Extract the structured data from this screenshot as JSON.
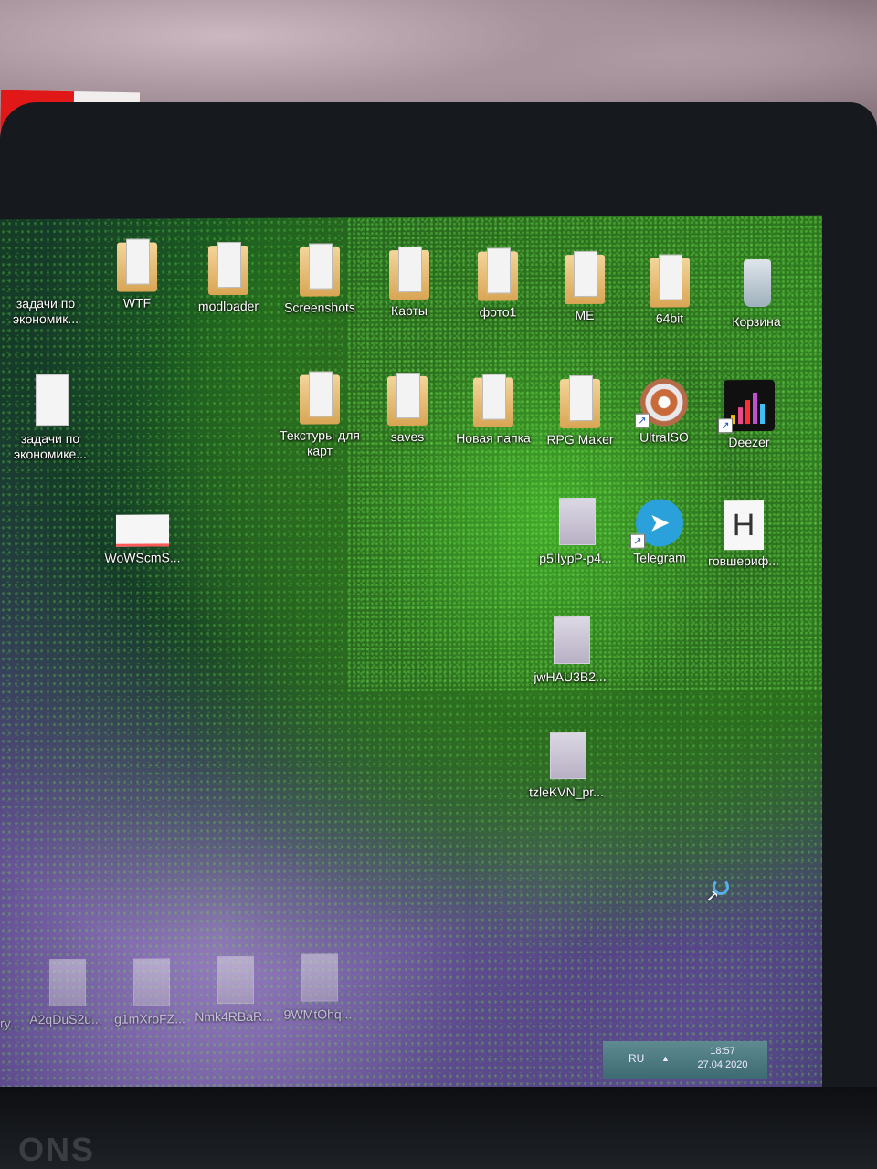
{
  "photo_brand": "ONS",
  "desktop": {
    "icons": [
      {
        "id": "zadachi1",
        "label": "задачи по экономик...",
        "kind": "doc"
      },
      {
        "id": "wtf",
        "label": "WTF",
        "kind": "folder"
      },
      {
        "id": "modloader",
        "label": "modloader",
        "kind": "folder"
      },
      {
        "id": "screenshots",
        "label": "Screenshots",
        "kind": "folder"
      },
      {
        "id": "karty",
        "label": "Карты",
        "kind": "folder"
      },
      {
        "id": "foto1",
        "label": "фото1",
        "kind": "folder"
      },
      {
        "id": "me",
        "label": "ME",
        "kind": "folder"
      },
      {
        "id": "64bit",
        "label": "64bit",
        "kind": "folder"
      },
      {
        "id": "korzina",
        "label": "Корзина",
        "kind": "recycle"
      },
      {
        "id": "zadachi2",
        "label": "задачи по экономике...",
        "kind": "doc"
      },
      {
        "id": "tekstury",
        "label": "Текстуры для карт",
        "kind": "folder"
      },
      {
        "id": "saves",
        "label": "saves",
        "kind": "folder"
      },
      {
        "id": "novaya",
        "label": "Новая папка",
        "kind": "folder"
      },
      {
        "id": "rpgmaker",
        "label": "RPG Maker",
        "kind": "folder"
      },
      {
        "id": "ultraiso",
        "label": "UltraISO",
        "kind": "app"
      },
      {
        "id": "deezer",
        "label": "Deezer",
        "kind": "app"
      },
      {
        "id": "wowscm",
        "label": "WoWScmS...",
        "kind": "image"
      },
      {
        "id": "p5lly",
        "label": "p5IIypP-p4...",
        "kind": "image"
      },
      {
        "id": "telegram",
        "label": "Telegram",
        "kind": "app"
      },
      {
        "id": "govsherif",
        "label": "говшериф...",
        "kind": "app"
      },
      {
        "id": "jwhau",
        "label": "jwHAU3B2...",
        "kind": "image"
      },
      {
        "id": "tzlekvn",
        "label": "tzleKVN_pr...",
        "kind": "image"
      },
      {
        "id": "a2q",
        "label": "A2qDuS2u...",
        "kind": "image"
      },
      {
        "id": "g1mx",
        "label": "g1mXroFZ...",
        "kind": "image"
      },
      {
        "id": "nmk4",
        "label": "Nmk4RBaR...",
        "kind": "image"
      },
      {
        "id": "9wmt",
        "label": "9WMtOhq...",
        "kind": "image"
      }
    ],
    "edge_fragment": "ry..."
  },
  "taskbar": {
    "language": "RU",
    "tray_arrow": "▲",
    "time": "18:57",
    "date": "27.04.2020"
  },
  "colors": {
    "telegram": "#2aa1da",
    "taskbar_tray": "#4d7a80",
    "folder": "#e2b466"
  }
}
